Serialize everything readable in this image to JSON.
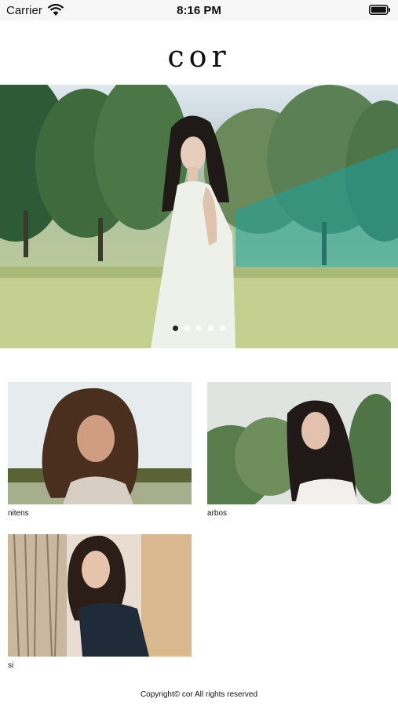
{
  "status_bar": {
    "carrier": "Carrier",
    "time": "8:16 PM"
  },
  "header": {
    "logo": "cor"
  },
  "carousel": {
    "total_slides": 5,
    "active_index": 0
  },
  "gallery": {
    "items": [
      {
        "label": "nitens"
      },
      {
        "label": "arbos"
      },
      {
        "label": "si"
      }
    ]
  },
  "footer": {
    "copyright": "Copyright© cor All rights reserved"
  }
}
